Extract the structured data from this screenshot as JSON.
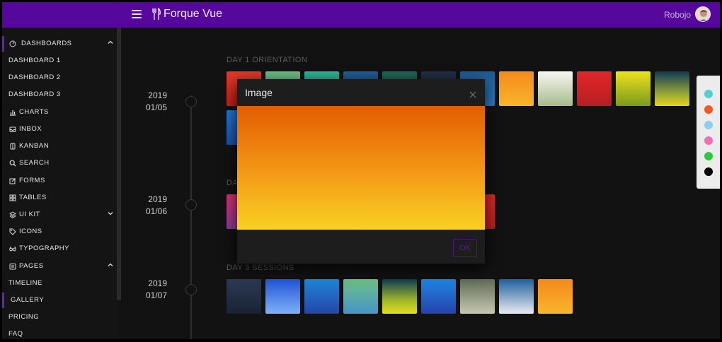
{
  "header": {
    "brand": "Forque Vue",
    "username": "Robojo"
  },
  "sidebar": {
    "items": [
      {
        "label": "DASHBOARDS",
        "icon": "gauge-icon",
        "expanded": true
      },
      {
        "label": "DASHBOARD 1"
      },
      {
        "label": "DASHBOARD 2"
      },
      {
        "label": "DASHBOARD 3"
      },
      {
        "label": "CHARTS",
        "icon": "bar-chart-icon"
      },
      {
        "label": "INBOX",
        "icon": "inbox-icon"
      },
      {
        "label": "KANBAN",
        "icon": "kanban-icon"
      },
      {
        "label": "SEARCH",
        "icon": "search-icon"
      },
      {
        "label": "FORMS",
        "icon": "edit-icon"
      },
      {
        "label": "TABLES",
        "icon": "grid-icon"
      },
      {
        "label": "UI KIT",
        "icon": "layers-icon",
        "expanded": false
      },
      {
        "label": "ICONS",
        "icon": "tag-icon"
      },
      {
        "label": "TYPOGRAPHY",
        "icon": "glasses-icon"
      },
      {
        "label": "PAGES",
        "icon": "pages-icon",
        "expanded": true
      },
      {
        "label": "TIMELINE"
      },
      {
        "label": "GALLERY",
        "active": true
      },
      {
        "label": "PRICING"
      },
      {
        "label": "FAQ"
      }
    ]
  },
  "timeline": [
    {
      "year": "2019",
      "day": "01/05",
      "title": "DAY 1 ORIENTATION"
    },
    {
      "year": "2019",
      "day": "01/06",
      "title": "DA"
    },
    {
      "year": "2019",
      "day": "01/07",
      "title": "DAY 3 SESSIONS"
    }
  ],
  "colors": {
    "accent": "#56079c",
    "picker": [
      "#4fd1d1",
      "#f2581f",
      "#8ccff0",
      "#f26fb3",
      "#2ec83a",
      "#000000"
    ]
  },
  "dialog": {
    "title": "Image",
    "ok_label": "OK"
  }
}
